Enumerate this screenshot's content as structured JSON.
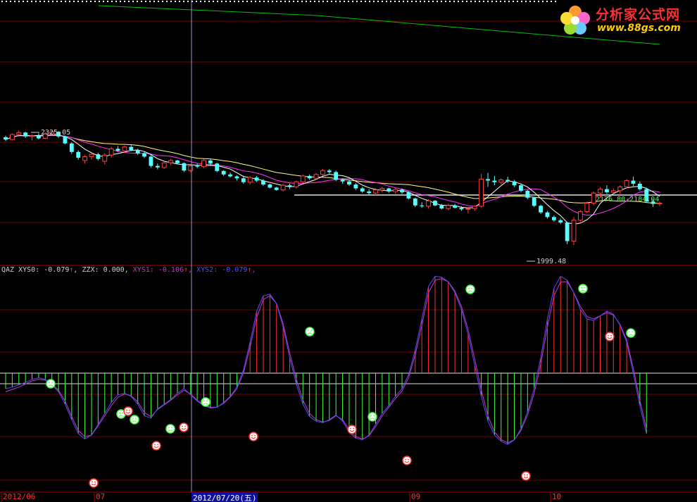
{
  "colors": {
    "up": "#ff4040",
    "down": "#54ffff",
    "ma_short": "#ffffff",
    "ma_mid": "#ff33ff",
    "ma_long": "#ffff80",
    "ma_far": "#00c000",
    "grid": "#7a0000",
    "osc_pos": "#ff3030",
    "osc_neg": "#40ff40",
    "xys1": "#cc33cc",
    "xys2": "#5050ff",
    "axis_text": "#ff3030",
    "highlight_text": "#ffffff",
    "highlight_bg": "#1010a0"
  },
  "brand": {
    "name": "分析家公式网",
    "url": "www.88gs.com"
  },
  "price_panel": {
    "annotations": {
      "high": "2325.05",
      "low": "1999.48",
      "range": "2176.80-2184.04"
    }
  },
  "indicator_header": {
    "name": "QAZ",
    "xys0_label": "XYS0:",
    "xys0_value": "-0.079",
    "zzx_label": "ZZX:",
    "zzx_value": "0.000,",
    "xys1_label": "XYS1:",
    "xys1_value": "-0.106",
    "xys2_label": "XYS2:",
    "xys2_value": "-0.079"
  },
  "time_axis": {
    "labels": [
      "2012/06",
      "07",
      "09",
      "10"
    ],
    "cursor_label": "2012/07/20(五)"
  },
  "chart_data": [
    {
      "type": "candlestick",
      "title": "",
      "series": [
        {
          "name": "price",
          "values": [
            [
              2308,
              2312,
              2298,
              2302
            ],
            [
              2302,
              2318,
              2300,
              2315
            ],
            [
              2315,
              2325,
              2310,
              2320
            ],
            [
              2320,
              2322,
              2306,
              2310
            ],
            [
              2310,
              2315,
              2300,
              2312
            ],
            [
              2312,
              2318,
              2302,
              2305
            ],
            [
              2305,
              2320,
              2303,
              2317
            ],
            [
              2317,
              2324,
              2312,
              2322
            ],
            [
              2322,
              2324,
              2306,
              2310
            ],
            [
              2310,
              2312,
              2290,
              2292
            ],
            [
              2292,
              2295,
              2265,
              2270
            ],
            [
              2270,
              2274,
              2250,
              2255
            ],
            [
              2248,
              2262,
              2240,
              2258
            ],
            [
              2258,
              2268,
              2250,
              2264
            ],
            [
              2264,
              2268,
              2248,
              2252
            ],
            [
              2246,
              2266,
              2238,
              2262
            ],
            [
              2262,
              2283,
              2255,
              2278
            ],
            [
              2278,
              2285,
              2270,
              2273
            ],
            [
              2273,
              2286,
              2268,
              2283
            ],
            [
              2283,
              2288,
              2272,
              2275
            ],
            [
              2275,
              2278,
              2262,
              2266
            ],
            [
              2266,
              2270,
              2254,
              2258
            ],
            [
              2258,
              2262,
              2230,
              2234
            ],
            [
              2234,
              2240,
              2225,
              2230
            ],
            [
              2230,
              2246,
              2226,
              2242
            ],
            [
              2242,
              2252,
              2236,
              2248
            ],
            [
              2248,
              2250,
              2238,
              2241
            ],
            [
              2241,
              2243,
              2218,
              2222
            ],
            [
              2222,
              2238,
              2218,
              2234
            ],
            [
              2234,
              2240,
              2228,
              2232
            ],
            [
              2232,
              2252,
              2228,
              2248
            ],
            [
              2248,
              2252,
              2236,
              2240
            ],
            [
              2240,
              2242,
              2218,
              2221
            ],
            [
              2221,
              2223,
              2208,
              2212
            ],
            [
              2212,
              2217,
              2204,
              2207
            ],
            [
              2207,
              2210,
              2196,
              2202
            ],
            [
              2202,
              2206,
              2188,
              2192
            ],
            [
              2192,
              2208,
              2186,
              2204
            ],
            [
              2204,
              2208,
              2192,
              2196
            ],
            [
              2196,
              2200,
              2182,
              2186
            ],
            [
              2186,
              2188,
              2176,
              2178
            ],
            [
              2178,
              2180,
              2170,
              2172
            ],
            [
              2172,
              2188,
              2168,
              2184
            ],
            [
              2184,
              2188,
              2174,
              2180
            ],
            [
              2180,
              2196,
              2176,
              2193
            ],
            [
              2193,
              2212,
              2190,
              2208
            ],
            [
              2208,
              2212,
              2198,
              2202
            ],
            [
              2202,
              2216,
              2198,
              2212
            ],
            [
              2212,
              2226,
              2208,
              2222
            ],
            [
              2222,
              2226,
              2214,
              2218
            ],
            [
              2218,
              2222,
              2195,
              2198
            ],
            [
              2198,
              2202,
              2188,
              2194
            ],
            [
              2194,
              2198,
              2182,
              2186
            ],
            [
              2186,
              2190,
              2172,
              2176
            ],
            [
              2176,
              2180,
              2164,
              2168
            ],
            [
              2168,
              2174,
              2160,
              2164
            ],
            [
              2164,
              2176,
              2158,
              2172
            ],
            [
              2172,
              2180,
              2166,
              2176
            ],
            [
              2176,
              2178,
              2164,
              2168
            ],
            [
              2168,
              2178,
              2162,
              2173
            ],
            [
              2173,
              2176,
              2162,
              2166
            ],
            [
              2166,
              2168,
              2148,
              2150
            ],
            [
              2150,
              2152,
              2128,
              2132
            ],
            [
              2132,
              2140,
              2126,
              2130
            ],
            [
              2130,
              2148,
              2124,
              2144
            ],
            [
              2144,
              2146,
              2130,
              2132
            ],
            [
              2132,
              2136,
              2122,
              2124
            ],
            [
              2124,
              2136,
              2120,
              2132
            ],
            [
              2132,
              2136,
              2124,
              2126
            ],
            [
              2126,
              2130,
              2118,
              2122
            ],
            [
              2122,
              2128,
              2112,
              2124
            ],
            [
              2124,
              2132,
              2118,
              2130
            ],
            [
              2130,
              2214,
              2126,
              2200
            ],
            [
              2200,
              2216,
              2180,
              2196
            ],
            [
              2196,
              2208,
              2184,
              2192
            ],
            [
              2192,
              2202,
              2186,
              2198
            ],
            [
              2198,
              2206,
              2190,
              2194
            ],
            [
              2194,
              2198,
              2180,
              2184
            ],
            [
              2184,
              2188,
              2166,
              2170
            ],
            [
              2170,
              2172,
              2148,
              2152
            ],
            [
              2152,
              2154,
              2128,
              2131
            ],
            [
              2131,
              2134,
              2110,
              2114
            ],
            [
              2114,
              2118,
              2098,
              2102
            ],
            [
              2102,
              2106,
              2090,
              2094
            ],
            [
              2094,
              2098,
              2084,
              2088
            ],
            [
              2088,
              2090,
              2032,
              2040
            ],
            [
              2040,
              2102,
              2030,
              2094
            ],
            [
              2094,
              2120,
              2090,
              2116
            ],
            [
              2116,
              2142,
              2112,
              2138
            ],
            [
              2138,
              2168,
              2132,
              2164
            ],
            [
              2164,
              2180,
              2152,
              2174
            ],
            [
              2174,
              2184,
              2162,
              2166
            ],
            [
              2166,
              2176,
              2160,
              2170
            ],
            [
              2170,
              2184,
              2162,
              2180
            ],
            [
              2180,
              2200,
              2176,
              2196
            ],
            [
              2196,
              2206,
              2182,
              2188
            ],
            [
              2188,
              2194,
              2170,
              2174
            ],
            [
              2174,
              2178,
              2138,
              2142
            ],
            [
              2142,
              2148,
              2128,
              2136
            ],
            [
              2136,
              2142,
              2130,
              2138
            ]
          ]
        }
      ]
    },
    {
      "type": "bar",
      "title": "QAZ",
      "series": [
        {
          "name": "XYS0",
          "values": [
            -20,
            -18,
            -15,
            -12,
            -8,
            -6,
            -8,
            -15,
            -24,
            -40,
            -60,
            -78,
            -85,
            -80,
            -66,
            -52,
            -38,
            -28,
            -26,
            -30,
            -40,
            -55,
            -58,
            -46,
            -40,
            -34,
            -26,
            -20,
            -28,
            -36,
            -42,
            -45,
            -44,
            -38,
            -30,
            -18,
            4,
            40,
            80,
            100,
            102,
            90,
            60,
            20,
            -14,
            -40,
            -56,
            -62,
            -64,
            -60,
            -54,
            -62,
            -76,
            -84,
            -86,
            -80,
            -66,
            -52,
            -42,
            -30,
            -20,
            -2,
            30,
            70,
            112,
            125,
            124,
            118,
            104,
            82,
            50,
            10,
            -30,
            -62,
            -80,
            -88,
            -92,
            -86,
            -72,
            -50,
            -20,
            20,
            70,
            110,
            125,
            120,
            104,
            82,
            70,
            68,
            74,
            80,
            76,
            62,
            40,
            0,
            -42,
            -78
          ]
        },
        {
          "name": "XYS1",
          "values": [
            -24,
            -21,
            -18,
            -14,
            -10,
            -8,
            -9,
            -14,
            -22,
            -36,
            -56,
            -74,
            -82,
            -80,
            -68,
            -55,
            -42,
            -31,
            -27,
            -29,
            -37,
            -51,
            -56,
            -47,
            -41,
            -35,
            -28,
            -22,
            -27,
            -35,
            -41,
            -44,
            -44,
            -39,
            -31,
            -20,
            0,
            34,
            72,
            95,
            100,
            90,
            64,
            26,
            -8,
            -35,
            -52,
            -60,
            -63,
            -61,
            -55,
            -60,
            -73,
            -82,
            -85,
            -81,
            -69,
            -55,
            -44,
            -33,
            -23,
            -6,
            24,
            62,
            104,
            120,
            122,
            118,
            106,
            86,
            56,
            18,
            -22,
            -55,
            -76,
            -86,
            -90,
            -86,
            -74,
            -54,
            -26,
            12,
            60,
            100,
            118,
            118,
            104,
            86,
            73,
            70,
            74,
            78,
            75,
            63,
            43,
            6,
            -35,
            -72
          ]
        },
        {
          "name": "XYS2",
          "values": [
            -20,
            -18,
            -15,
            -12,
            -8,
            -6,
            -8,
            -15,
            -24,
            -40,
            -60,
            -78,
            -85,
            -80,
            -66,
            -52,
            -38,
            -28,
            -26,
            -30,
            -40,
            -55,
            -58,
            -46,
            -40,
            -34,
            -26,
            -20,
            -28,
            -36,
            -42,
            -45,
            -44,
            -38,
            -30,
            -18,
            4,
            40,
            80,
            100,
            102,
            90,
            60,
            20,
            -14,
            -40,
            -56,
            -62,
            -64,
            -60,
            -54,
            -62,
            -76,
            -84,
            -86,
            -80,
            -66,
            -52,
            -42,
            -30,
            -20,
            -2,
            30,
            70,
            112,
            125,
            124,
            118,
            104,
            82,
            50,
            10,
            -30,
            -62,
            -80,
            -88,
            -92,
            -86,
            -72,
            -50,
            -20,
            20,
            70,
            110,
            125,
            120,
            104,
            82,
            70,
            68,
            74,
            80,
            76,
            62,
            40,
            0,
            -42,
            -78
          ]
        }
      ]
    }
  ]
}
